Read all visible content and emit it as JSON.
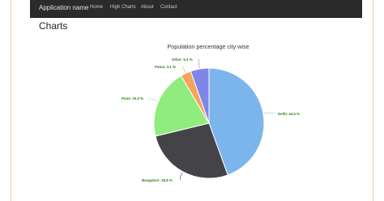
{
  "app": {
    "brand": "Application name",
    "nav": [
      "Home",
      "High Charts",
      "About",
      "Contact"
    ]
  },
  "page": {
    "title": "Charts"
  },
  "chart_data": {
    "type": "pie",
    "title": "Population percentage city wise",
    "slices": [
      {
        "label": "Delhi",
        "value": 44.5,
        "color": "#7cb5ec",
        "text": "Delhi: 44.5 %"
      },
      {
        "label": "Bangalore",
        "value": 26.8,
        "color": "#434348",
        "text": "Bangalore: 26.8 %"
      },
      {
        "label": "Pune",
        "value": 20.3,
        "color": "#90ed7d",
        "text": "Pune: 20.3 %"
      },
      {
        "label": "Patna",
        "value": 3.1,
        "color": "#f7a35c",
        "text": "Patna: 3.1 %"
      },
      {
        "label": "Other",
        "value": 5.4,
        "color": "#8085e9",
        "text": "Other: 5.4 %"
      }
    ]
  }
}
